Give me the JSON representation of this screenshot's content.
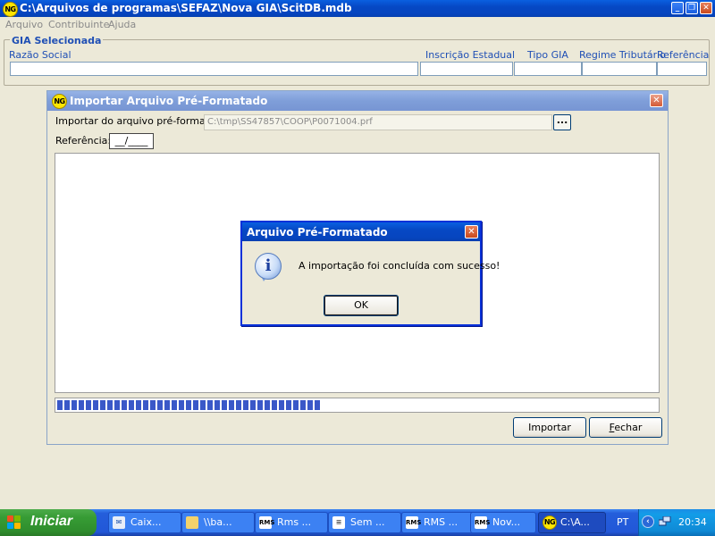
{
  "main_window": {
    "title": "C:\\Arquivos de programas\\SEFAZ\\Nova GIA\\ScitDB.mdb",
    "logo": "NG",
    "caption_buttons": [
      "minimize-icon",
      "restore-icon",
      "close-icon"
    ]
  },
  "menu": [
    "Arquivo",
    "Contribuinte",
    "Ajuda"
  ],
  "gia_group": {
    "legend": "GIA Selecionada",
    "columns": [
      "Razão Social",
      "Inscrição Estadual",
      "Tipo GIA",
      "Regime Tributário",
      "Referência"
    ]
  },
  "import_dialog": {
    "title": "Importar Arquivo Pré-Formatado",
    "file_label": "Importar do arquivo pré-formatado:",
    "file_value": "C:\\tmp\\SS47857\\COOP\\P0071004.prf",
    "browse_label": "...",
    "ref_label": "Referência:",
    "ref_value": "__/____",
    "progress_fraction": 0.44,
    "import_button": "Importar",
    "close_button": "Fechar"
  },
  "message_box": {
    "title": "Arquivo Pré-Formatado",
    "message": "A importação foi concluída com sucesso!",
    "icon": "info-icon",
    "ok_label": "OK"
  },
  "taskbar": {
    "start_label": "Iniciar",
    "buttons": [
      {
        "label": "Caix...",
        "icon": "outlook-icon"
      },
      {
        "label": "\\\\ba...",
        "icon": "folder-icon"
      },
      {
        "label": "Rms ...",
        "icon": "rms-icon"
      },
      {
        "label": "Sem ...",
        "icon": "notepad-icon"
      },
      {
        "label": "RMS ...",
        "icon": "rms-icon"
      },
      {
        "label": "Nov...",
        "icon": "rms-icon"
      },
      {
        "label": "C:\\A...",
        "icon": "ng-icon"
      }
    ],
    "language": "PT",
    "clock": "20:34"
  },
  "colors": {
    "xp_blue": "#0648c4",
    "window_face": "#ece9d8",
    "label_blue": "#1f4fb5",
    "progress": "#3a58c8",
    "start_green": "#379c35",
    "desktop": "#808080"
  }
}
